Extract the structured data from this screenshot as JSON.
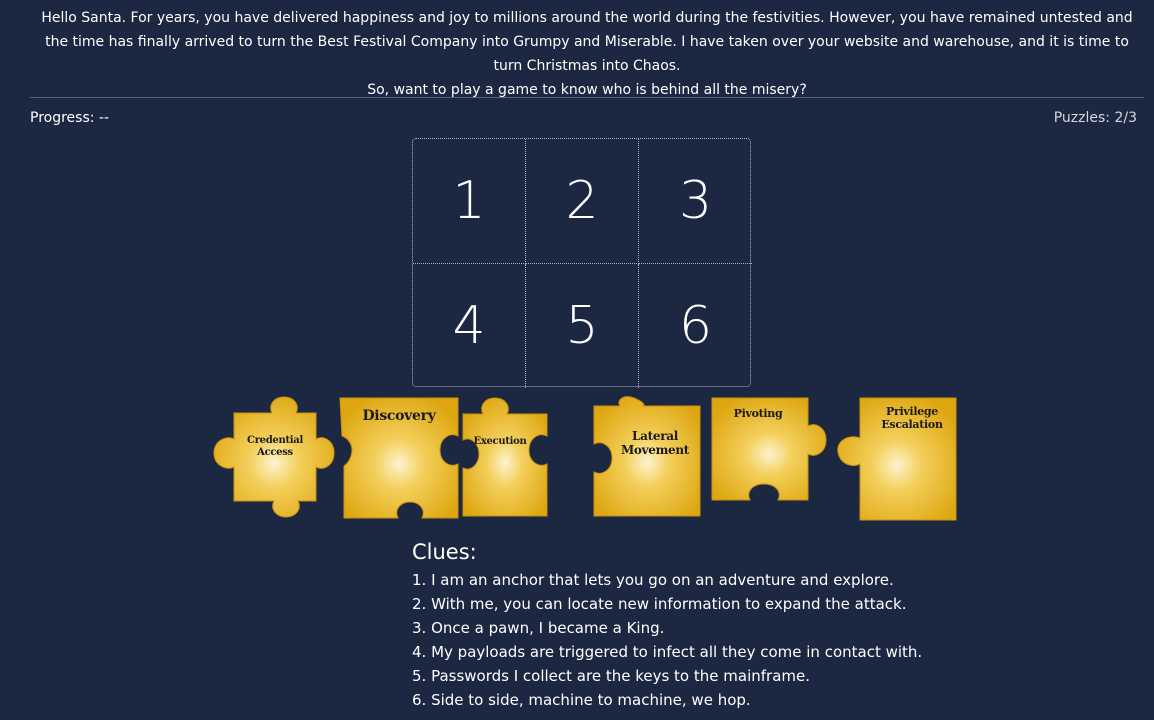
{
  "intro": {
    "line1": "Hello Santa. For years, you have delivered happiness and joy to millions around the world during the festivities. However, you have remained untested and the time has finally arrived to turn the Best Festival Company into Grumpy and Miserable. I have taken over your website and warehouse, and it is time to turn Christmas into Chaos.",
    "line2": "So, want to play a game to know who is behind all the misery?"
  },
  "status": {
    "progress": "Progress: --",
    "puzzles": "Puzzles: 2/3"
  },
  "grid": {
    "cells": [
      "1",
      "2",
      "3",
      "4",
      "5",
      "6"
    ]
  },
  "pieces": {
    "credential_access": {
      "line1": "Credential",
      "line2": "Access"
    },
    "discovery": {
      "line1": "Discovery"
    },
    "execution": {
      "line1": "Execution"
    },
    "lateral_movement": {
      "line1": "Lateral",
      "line2": "Movement"
    },
    "pivoting": {
      "line1": "Pivoting"
    },
    "privilege_escalation": {
      "line1": "Privilege",
      "line2": "Escalation"
    }
  },
  "colors": {
    "background": "#1c2742",
    "piece_gold": "#e8b21a",
    "piece_highlight": "#fdf3cf"
  },
  "clues": {
    "title": "Clues:",
    "items": [
      "1. I am an anchor that lets you go on an adventure and explore.",
      "2. With me, you can locate new information to expand the attack.",
      "3. Once a pawn, I became a King.",
      "4. My payloads are triggered to infect all they come in contact with.",
      "5. Passwords I collect are the keys to the mainframe.",
      "6. Side to side, machine to machine, we hop."
    ]
  }
}
